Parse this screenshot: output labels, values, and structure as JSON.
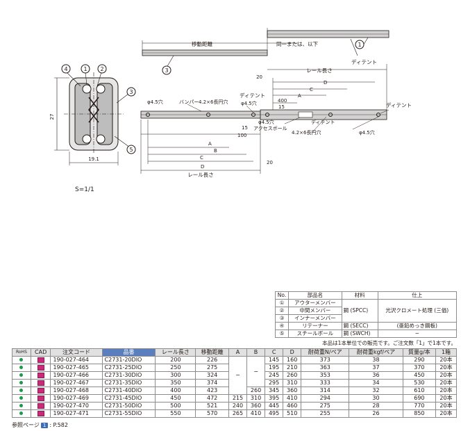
{
  "drawing": {
    "labels": {
      "travel": "移動距離",
      "same_or_less": "同一または、以下",
      "detent": "ディテント",
      "rail_length": "レール長さ",
      "bumper": "バンパー",
      "slot": "4.2×6長円穴",
      "hole": "φ4.5穴",
      "access_ball": "アクセスボール",
      "A": "A",
      "B": "B",
      "C": "C",
      "D": "D",
      "n20": "20",
      "n400": "400",
      "n15": "15",
      "n100": "100",
      "n27": "27",
      "n19_1": "19.1",
      "c1": "1",
      "c2": "2",
      "c3": "3",
      "c4": "4",
      "c5": "5"
    },
    "scale": "S=1/1"
  },
  "parts_table": {
    "headers": [
      "No.",
      "部品名",
      "材料",
      "仕上"
    ],
    "rows": [
      {
        "no": "①",
        "name": "アウターメンバー",
        "material": "",
        "finish": ""
      },
      {
        "no": "②",
        "name": "中間メンバー",
        "material": "鋼 (SPCC)",
        "finish": "光沢クロメート処理 (三価)"
      },
      {
        "no": "③",
        "name": "インナーメンバー",
        "material": "",
        "finish": ""
      },
      {
        "no": "④",
        "name": "リテーナー",
        "material": "鋼 (SECC)",
        "finish": "(亜鉛めっき鋼板)"
      },
      {
        "no": "⑤",
        "name": "スチールボール",
        "material": "鋼 (SWCH)",
        "finish": "−"
      }
    ]
  },
  "note": "本品は1本単位での販売です。ご注文数「1」で1本です。",
  "spec_table": {
    "headers": [
      "RoHS",
      "CAD",
      "注文コード",
      "品番",
      "レール長さ",
      "移動距離",
      "A",
      "B",
      "C",
      "D",
      "耐荷重N/ペア",
      "耐荷重kgf/ペア",
      "質量g/本",
      "1箱"
    ],
    "rows": [
      [
        "190-027-464",
        "C2731-20DIO",
        "200",
        "226",
        "",
        "",
        "145",
        "160",
        "373",
        "38",
        "290",
        "20本"
      ],
      [
        "190-027-465",
        "C2731-25DIO",
        "250",
        "275",
        "",
        "",
        "195",
        "210",
        "363",
        "37",
        "370",
        "20本"
      ],
      [
        "190-027-466",
        "C2731-30DIO",
        "300",
        "324",
        "−",
        "−",
        "245",
        "260",
        "353",
        "36",
        "450",
        "20本"
      ],
      [
        "190-027-467",
        "C2731-35DIO",
        "350",
        "374",
        "",
        "",
        "295",
        "310",
        "333",
        "34",
        "530",
        "20本"
      ],
      [
        "190-027-468",
        "C2731-40DIO",
        "400",
        "423",
        "",
        "260",
        "345",
        "360",
        "314",
        "32",
        "610",
        "20本"
      ],
      [
        "190-027-469",
        "C2731-45DIO",
        "450",
        "472",
        "215",
        "310",
        "395",
        "410",
        "294",
        "30",
        "690",
        "20本"
      ],
      [
        "190-027-470",
        "C2731-50DIO",
        "500",
        "521",
        "240",
        "360",
        "445",
        "460",
        "275",
        "28",
        "770",
        "20本"
      ],
      [
        "190-027-471",
        "C2731-55DIO",
        "550",
        "570",
        "265",
        "410",
        "495",
        "510",
        "255",
        "26",
        "850",
        "20本"
      ]
    ]
  },
  "ref": {
    "prefix": "参照ページ",
    "badge": "1",
    "page": ": P.582"
  }
}
